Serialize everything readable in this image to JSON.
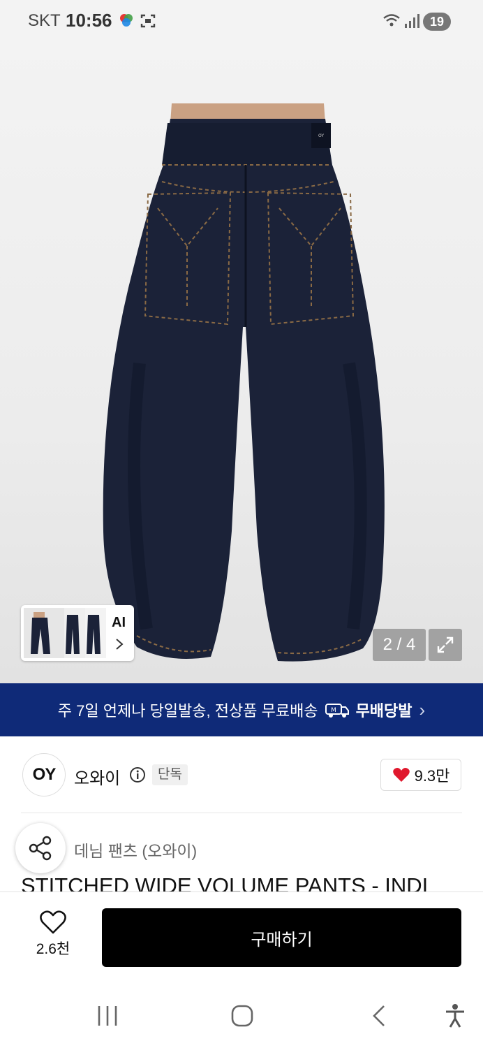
{
  "status_bar": {
    "carrier": "SKT",
    "time": "10:56",
    "battery": "19"
  },
  "header": {
    "back_icon": "chevron-left-icon",
    "home_icon": "home-icon",
    "search_icon": "search-icon",
    "bag_icon": "shopping-bag-icon"
  },
  "gallery": {
    "page_indicator": "2 / 4",
    "thumb_ai_label": "AI",
    "expand_icon": "expand-icon"
  },
  "banner": {
    "text": "주 7일 언제나 당일발송, 전상품 무료배송",
    "badge": "무배당발",
    "chevron": "›"
  },
  "brand": {
    "logo_text": "OY",
    "name": "오와이",
    "tag": "단독",
    "likes": "9.3만"
  },
  "product": {
    "category": "데님 팬츠 (오와이)",
    "title": "STITCHED WIDE VOLUME PANTS - INDI"
  },
  "action_bar": {
    "wish_count": "2.6천",
    "buy_label": "구매하기"
  },
  "colors": {
    "banner_bg": "#0f2a78",
    "heart": "#e0182d",
    "buy_bg": "#000000",
    "denim": "#1b2238"
  }
}
